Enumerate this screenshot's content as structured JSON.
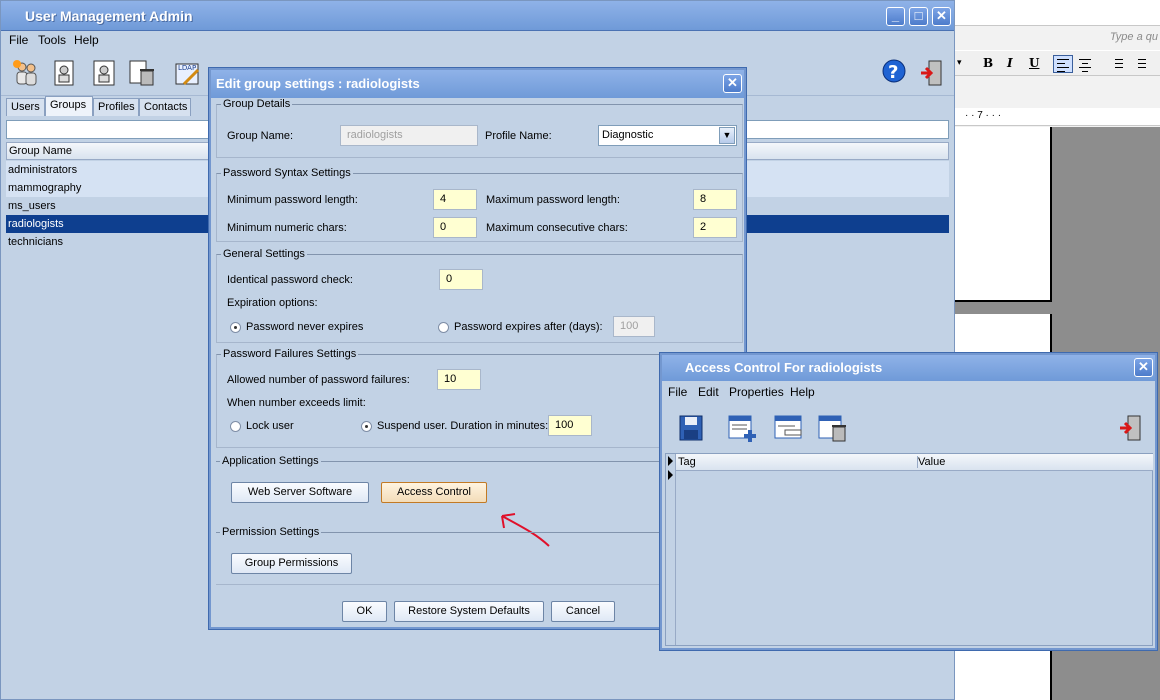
{
  "main": {
    "title": "User Management Admin",
    "menu": [
      "File",
      "Tools",
      "Help"
    ],
    "tabs": [
      "Users",
      "Groups",
      "Profiles",
      "Contacts"
    ],
    "grid_header": "Group Name",
    "groups": [
      "administrators",
      "mammography",
      "ms_users",
      "radiologists",
      "technicians"
    ]
  },
  "word": {
    "ask_placeholder": "Type a qu",
    "ruler": "· · 7 · · ·"
  },
  "edit_dialog": {
    "title": "Edit group settings : radiologists",
    "group_details": {
      "legend": "Group Details",
      "group_name_label": "Group Name:",
      "group_name_value": "radiologists",
      "profile_name_label": "Profile Name:",
      "profile_name_value": "Diagnostic"
    },
    "password_syntax": {
      "legend": "Password Syntax Settings",
      "min_length_label": "Minimum password length:",
      "min_length_value": "4",
      "max_length_label": "Maximum password length:",
      "max_length_value": "8",
      "min_numeric_label": "Minimum numeric chars:",
      "min_numeric_value": "0",
      "max_consecutive_label": "Maximum consecutive chars:",
      "max_consecutive_value": "2"
    },
    "general": {
      "legend": "General Settings",
      "identical_label": "Identical password check:",
      "identical_value": "0",
      "expiration_label": "Expiration options:",
      "never_expires_label": "Password never expires",
      "expires_after_label": "Password expires after (days):",
      "expires_after_value": "100"
    },
    "failures": {
      "legend": "Password Failures Settings",
      "allowed_label": "Allowed number of password failures:",
      "allowed_value": "10",
      "exceeds_label": "When number exceeds limit:",
      "lock_user_label": "Lock user",
      "suspend_label": "Suspend user. Duration in minutes:",
      "suspend_value": "100"
    },
    "application": {
      "legend": "Application Settings",
      "web_server_button": "Web Server Software",
      "access_control_button": "Access Control"
    },
    "permission": {
      "legend": "Permission Settings",
      "group_permissions_button": "Group Permissions"
    },
    "buttons": {
      "ok": "OK",
      "restore": "Restore System Defaults",
      "cancel": "Cancel"
    }
  },
  "access_control": {
    "title": "Access Control For radiologists",
    "menu": [
      "File",
      "Edit",
      "Properties",
      "Help"
    ],
    "columns": [
      "Tag",
      "Value"
    ]
  },
  "colors": {
    "titlebar": "#6f9ad8",
    "window_bg": "#c2d2e5",
    "selection": "#0e3f8f",
    "annotation_arrow": "#e0102a"
  }
}
